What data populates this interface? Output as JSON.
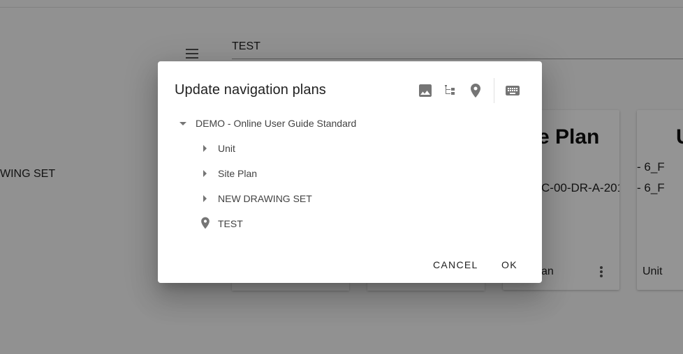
{
  "background": {
    "header_value": "TEST",
    "left_label": "WING SET",
    "cards": [
      {
        "title": "e Plan",
        "lines": [
          "C-00-DR-A-201"
        ],
        "footer": "an"
      },
      {
        "title": "U",
        "lines": [
          "- 6_F",
          "- 6_F"
        ],
        "footer": "Unit"
      }
    ]
  },
  "dialog": {
    "title": "Update navigation plans",
    "toolbar": [
      {
        "icon": "image-icon"
      },
      {
        "icon": "tree-structure-icon"
      },
      {
        "icon": "location-pin-icon"
      },
      {
        "icon": "keyboard-icon"
      }
    ],
    "tree": {
      "root": "DEMO - Online User Guide Standard",
      "children": [
        {
          "label": "Unit",
          "type": "folder"
        },
        {
          "label": "Site Plan",
          "type": "folder"
        },
        {
          "label": "NEW DRAWING SET",
          "type": "folder"
        },
        {
          "label": "TEST",
          "type": "location"
        }
      ]
    },
    "actions": {
      "cancel": "CANCEL",
      "ok": "OK"
    }
  }
}
